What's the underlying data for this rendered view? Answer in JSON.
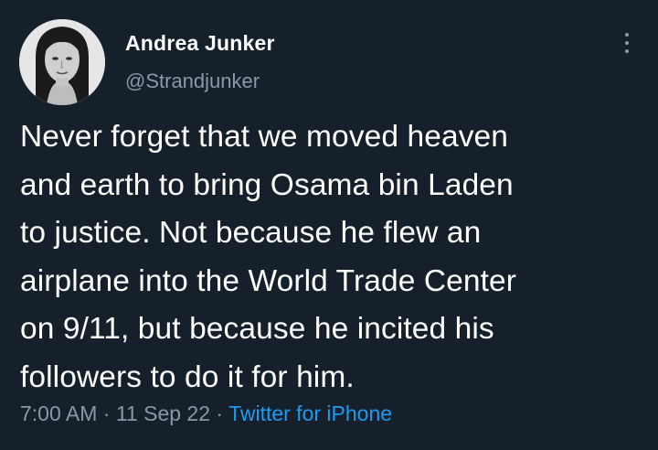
{
  "author": {
    "name": "Andrea Junker",
    "handle": "@Strandjunker"
  },
  "tweet": {
    "text": "Never forget that we moved heaven\nand earth to bring Osama bin Laden\nto justice. Not because he flew an\nairplane into the World Trade Center\non 9/11, but because he incited his\nfollowers to do it for him."
  },
  "meta": {
    "time": "7:00 AM",
    "date": "11 Sep 22",
    "separator": "·",
    "source": "Twitter for iPhone"
  },
  "icons": {
    "more": "more-vertical-icon"
  },
  "colors": {
    "background": "#15202b",
    "text": "#ffffff",
    "secondary": "#8b98a5",
    "link": "#1d9bf0"
  }
}
